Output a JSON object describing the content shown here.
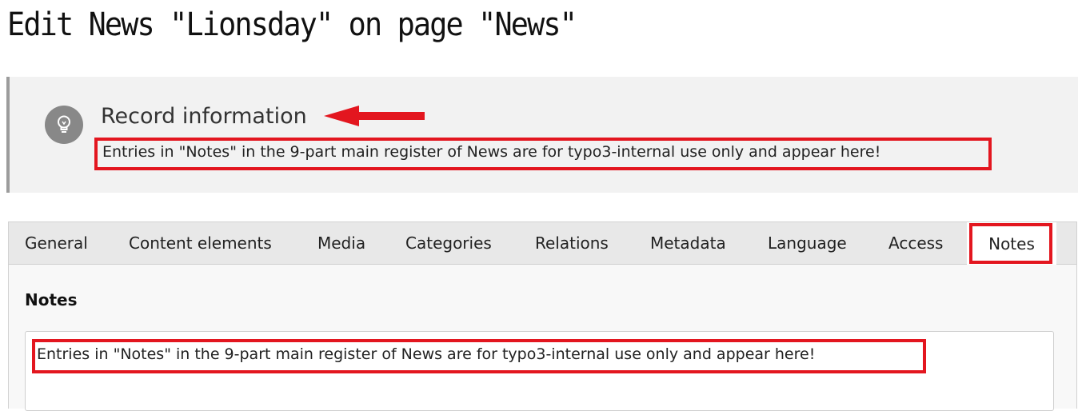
{
  "page": {
    "title": "Edit News \"Lionsday\" on page \"News\""
  },
  "record_info": {
    "icon": "lightbulb-icon",
    "title": "Record information",
    "message": "Entries in \"Notes\" in the 9-part main register of News are for typo3-internal use only and appear here!",
    "highlight_color": "#e3161f"
  },
  "tabs": [
    {
      "label": "General"
    },
    {
      "label": "Content elements"
    },
    {
      "label": "Media"
    },
    {
      "label": "Categories"
    },
    {
      "label": "Relations"
    },
    {
      "label": "Metadata"
    },
    {
      "label": "Language"
    },
    {
      "label": "Access"
    },
    {
      "label": "Notes",
      "active": true
    }
  ],
  "notes_tab": {
    "field_label": "Notes",
    "value": "Entries in \"Notes\" in the 9-part main register of News are for typo3-internal use only and appear here!"
  }
}
